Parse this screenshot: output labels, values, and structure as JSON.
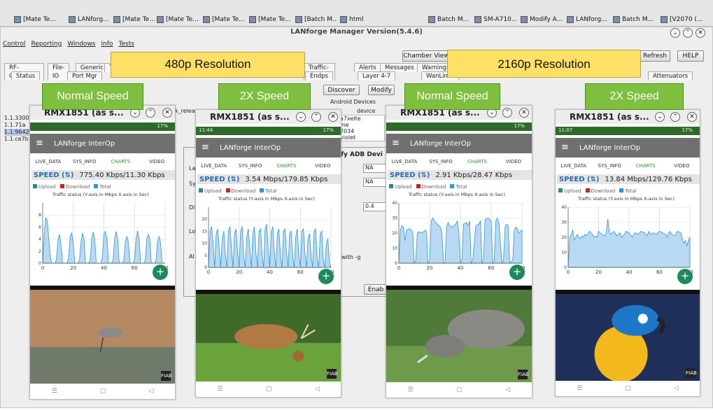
{
  "taskbar": {
    "items": [
      "[Mate Te...",
      "LANforg...",
      "[Mate Te...",
      "[Mate Te...",
      "[Mate Te...",
      "[Mate Te...",
      "[Batch M...",
      "html",
      "Batch M...",
      "SM-A710...",
      "Modify A...",
      "LANforg...",
      "Batch M...",
      "[V2070 (..."
    ]
  },
  "manager": {
    "title": "LANforge Manager  Version(5.4.6)",
    "menu": [
      "Control",
      "Reporting",
      "Windows",
      "Info",
      "Tests"
    ],
    "chamber_view": "Chamber View",
    "refresh": "Refresh",
    "help": "HELP",
    "tabs_row1": [
      "RF-Generator",
      "File-IO",
      "Generic",
      "T",
      "Traffic-Profiles",
      "Alerts",
      "Messages",
      "Warnings"
    ],
    "tabs_row2": [
      "Status",
      "Port Mgr",
      "Endps",
      "Layer 4-7",
      "WanLinks",
      "Attenuators"
    ],
    "discover": "Discover",
    "modify": "Modify",
    "android_devices": "Android Devices",
    "device_col": "device",
    "rel_col": "k_relea",
    "devices": [
      "a7xelte",
      "me",
      "2034",
      "violet"
    ],
    "left_ips": [
      "1.1.3300",
      "1.1.71a",
      "1.1.9642",
      "1.1.ce7b"
    ],
    "modify_adb": "ify ADB Devi",
    "na1": "NA",
    "na2": "NA",
    "val": "0.4",
    "with_g": "with -g",
    "enab": "Enab",
    "labels": [
      "La",
      "Sy",
      "Di",
      "Lo",
      "Al"
    ]
  },
  "captions": {
    "res_480": "480p Resolution",
    "res_2160": "2160p Resolution",
    "speeds": [
      "Normal Speed",
      "2X Speed",
      "Normal Speed",
      "2X Speed"
    ]
  },
  "phones": [
    {
      "title": "RMX1851 (as s...",
      "time": "",
      "battery": "17%",
      "app": "LANforge InterOp",
      "tabs": [
        "LIVE_DATA",
        "SYS_INFO",
        "CHARTS",
        "VIDEO"
      ],
      "speed_label": "SPEED (⇅)",
      "speed_val": "775.40 Kbps/11.30 Kbps",
      "legend": [
        "Upload",
        "Download",
        "Total"
      ],
      "chart_title": "Traffic status (Y-axis in Mbps X-axis in Sec)",
      "fab": "+",
      "logo": "FIAB"
    },
    {
      "title": "RMX1851 (as s...",
      "time": "11:44",
      "battery": "17%",
      "app": "LANforge InterOp",
      "tabs": [
        "LIVE_DATA",
        "SYS_INFO",
        "CHARTS",
        "VIDEO"
      ],
      "speed_label": "SPEED (⇅)",
      "speed_val": "3.54 Mbps/179.85 Kbps",
      "legend": [
        "Upload",
        "Download",
        "Total"
      ],
      "chart_title": "Traffic status (Y-axis in Mbps X-axis in Sec)",
      "fab": "+",
      "logo": "FIAB"
    },
    {
      "title": "RMX1851 (as s...",
      "time": "",
      "battery": "17%",
      "app": "LANforge InterOp",
      "tabs": [
        "LIVE_DATA",
        "SYS_INFO",
        "CHARTS",
        "VIDEO"
      ],
      "speed_label": "SPEED (⇅)",
      "speed_val": "2.91 Kbps/28.47 Kbps",
      "legend": [
        "Upload",
        "Download",
        "Total"
      ],
      "chart_title": "Traffic status (Y-axis in Mbps X-axis in Sec)",
      "fab": "+",
      "logo": "FIAB"
    },
    {
      "title": "RMX1851 (as s...",
      "time": "11:07",
      "battery": "17%",
      "app": "LANforge InterOp",
      "tabs": [
        "LIVE_DATA",
        "SYS_INFO",
        "CHARTS",
        "VIDEO"
      ],
      "speed_label": "SPEED (⇅)",
      "speed_val": "13.84 Mbps/129.76 Kbps",
      "legend": [
        "Upload",
        "Download",
        "Total"
      ],
      "chart_title": "Traffic status (Y-axis in Mbps X-axis in Sec)",
      "fab": "+",
      "logo": "FIAB"
    }
  ],
  "colors": {
    "upload": "#2a8a8a",
    "download": "#cc2222",
    "total": "#2a9ad6",
    "accent_green": "#7fbf3f",
    "caption_yellow": "#ffe066",
    "status_green": "#2e6b2a"
  },
  "chart_data": [
    {
      "type": "area",
      "title": "Traffic status (Y-axis in Mbps X-axis in Sec)",
      "xlim": [
        0,
        80
      ],
      "ylim": [
        0,
        10
      ],
      "xticks": [
        0,
        20,
        40,
        60,
        80
      ],
      "yticks": [
        0,
        2,
        4,
        6,
        8
      ],
      "x": [
        0,
        1,
        2,
        3,
        4,
        5,
        6,
        8,
        9,
        10,
        11,
        12,
        13,
        16,
        17,
        18,
        19,
        20,
        21,
        23,
        24,
        25,
        26,
        27,
        28,
        30,
        31,
        32,
        33,
        34,
        35,
        38,
        39,
        40,
        41,
        42,
        43,
        45,
        46,
        47,
        48,
        49,
        50,
        52,
        53,
        54,
        55,
        56,
        57,
        59,
        60,
        61,
        62,
        63,
        64,
        66,
        67,
        68,
        69,
        70,
        71,
        73,
        74,
        75,
        76,
        77,
        78,
        80
      ],
      "y": [
        0,
        5,
        7.6,
        7,
        4,
        1,
        0,
        0,
        0.6,
        4,
        4.8,
        3,
        0,
        0,
        1,
        4.5,
        5,
        3,
        0,
        0,
        0.5,
        3.5,
        5,
        4,
        0,
        0,
        0.5,
        4,
        5.2,
        4,
        0,
        0,
        1,
        4.8,
        5.3,
        4,
        0,
        0,
        0.5,
        4,
        5.3,
        4,
        0,
        0,
        0.5,
        3.5,
        4.5,
        3.5,
        0,
        0,
        0.5,
        4,
        5.4,
        4,
        0,
        0,
        0.5,
        4,
        4.8,
        4,
        0,
        0,
        0.5,
        3.5,
        4.5,
        3.5,
        0,
        0
      ]
    },
    {
      "type": "area",
      "title": "Traffic status (Y-axis in Mbps X-axis in Sec)",
      "xlim": [
        0,
        80
      ],
      "ylim": [
        0,
        25
      ],
      "xticks": [
        0,
        20,
        40,
        60,
        80
      ],
      "yticks": [
        0,
        5,
        10,
        15,
        20
      ],
      "x": [
        0,
        1,
        2,
        3,
        4,
        5,
        6,
        7,
        8,
        9,
        10,
        11,
        12,
        13,
        14,
        15,
        16,
        17,
        18,
        19,
        20,
        21,
        22,
        23,
        24,
        25,
        26,
        27,
        28,
        29,
        30,
        31,
        32,
        33,
        34,
        35,
        36,
        37,
        38,
        39,
        40,
        41,
        42,
        43,
        44,
        45,
        46,
        47,
        48,
        49,
        50,
        51,
        52,
        53,
        54,
        55,
        56,
        57,
        58,
        59,
        60,
        61,
        62,
        63,
        64,
        65,
        66,
        67,
        68,
        69,
        70,
        71,
        72,
        73,
        74,
        75,
        76,
        77,
        78,
        79,
        80
      ],
      "y": [
        0,
        15,
        17,
        10,
        0,
        14,
        16,
        8,
        0,
        12,
        15,
        5,
        0,
        15,
        17,
        8,
        0,
        14,
        16,
        6,
        0,
        15,
        17,
        5,
        0,
        13,
        16,
        8,
        0,
        14,
        17,
        6,
        0,
        15,
        16,
        5,
        0,
        16,
        18,
        8,
        0,
        15,
        17,
        6,
        0,
        14,
        16,
        5,
        0,
        15,
        16,
        6,
        0,
        14,
        15,
        5,
        0,
        13,
        16,
        5,
        0,
        15,
        16,
        6,
        0,
        12,
        14,
        5,
        0,
        15,
        16,
        4,
        0,
        14,
        15,
        3,
        0,
        10,
        12,
        2,
        0
      ]
    },
    {
      "type": "area",
      "title": "Traffic status (Y-axis in Mbps X-axis in Sec)",
      "xlim": [
        0,
        80
      ],
      "ylim": [
        0,
        40
      ],
      "xticks": [
        0,
        20,
        40,
        60,
        80
      ],
      "yticks": [
        0,
        10,
        20,
        30,
        40
      ],
      "x": [
        0,
        1,
        2,
        3,
        4,
        5,
        7,
        9,
        10,
        11,
        12,
        13,
        15,
        17,
        18,
        19,
        20,
        21,
        22,
        24,
        25,
        26,
        27,
        28,
        29,
        30,
        31,
        32,
        33,
        35,
        37,
        38,
        39,
        40,
        41,
        42,
        44,
        45,
        46,
        47,
        48,
        50,
        52,
        53,
        54,
        55,
        56,
        58,
        60,
        61,
        62,
        63,
        64,
        65,
        67,
        68,
        69,
        70,
        71,
        72,
        74,
        75,
        76,
        77,
        78,
        80
      ],
      "y": [
        0,
        22,
        25,
        24,
        15,
        22,
        23,
        21,
        0,
        2,
        20,
        21,
        20,
        22,
        21,
        0,
        2,
        28,
        30,
        27,
        26,
        25,
        24,
        20,
        0,
        1,
        24,
        27,
        25,
        24,
        26,
        28,
        20,
        0,
        3,
        26,
        27,
        25,
        28,
        0,
        2,
        25,
        26,
        28,
        0,
        2,
        29,
        30,
        28,
        0,
        2,
        28,
        30,
        27,
        0,
        2,
        24,
        26,
        25,
        0,
        2,
        22,
        24,
        23,
        20,
        22
      ]
    },
    {
      "type": "area",
      "title": "Traffic status (Y-axis in Mbps X-axis in Sec)",
      "xlim": [
        0,
        80
      ],
      "ylim": [
        0,
        40
      ],
      "xticks": [
        0,
        20,
        40,
        60,
        80
      ],
      "yticks": [
        0,
        10,
        20,
        30,
        40
      ],
      "x": [
        0,
        1,
        2,
        3,
        4,
        5,
        6,
        7,
        8,
        9,
        10,
        11,
        12,
        14,
        16,
        17,
        18,
        19,
        20,
        22,
        24,
        25,
        26,
        27,
        28,
        30,
        32,
        34,
        35,
        36,
        37,
        38,
        40,
        42,
        43,
        44,
        46,
        48,
        50,
        51,
        52,
        53,
        54,
        56,
        58,
        60,
        62,
        64,
        65,
        66,
        67,
        68,
        70,
        72,
        74,
        75,
        76,
        77,
        78,
        79,
        80
      ],
      "y": [
        0,
        20,
        22,
        25,
        18,
        20,
        22,
        20,
        19,
        21,
        20,
        22,
        21,
        24,
        22,
        20,
        21,
        20,
        24,
        22,
        21,
        23,
        32,
        24,
        22,
        24,
        21,
        23,
        20,
        21,
        22,
        24,
        23,
        20,
        22,
        23,
        22,
        24,
        23,
        22,
        21,
        24,
        22,
        23,
        22,
        24,
        23,
        22,
        20,
        23,
        24,
        22,
        21,
        24,
        23,
        19,
        16,
        18,
        14,
        18,
        20
      ]
    }
  ]
}
